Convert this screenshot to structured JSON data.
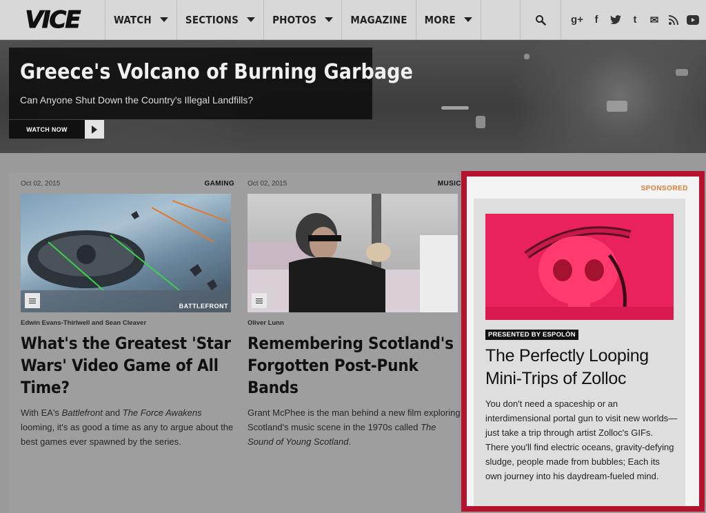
{
  "nav": {
    "logo": "VICE",
    "items": [
      {
        "label": "WATCH",
        "dropdown": true
      },
      {
        "label": "SECTIONS",
        "dropdown": true
      },
      {
        "label": "PHOTOS",
        "dropdown": true
      },
      {
        "label": "MAGAZINE",
        "dropdown": false
      },
      {
        "label": "MORE",
        "dropdown": true
      }
    ],
    "social": [
      {
        "name": "google-plus-icon",
        "glyph": "g+"
      },
      {
        "name": "facebook-icon",
        "glyph": "f"
      },
      {
        "name": "twitter-icon",
        "glyph": "t"
      },
      {
        "name": "tumblr-icon",
        "glyph": "t"
      },
      {
        "name": "mail-icon",
        "glyph": "✉"
      },
      {
        "name": "rss-icon",
        "glyph": "◥"
      },
      {
        "name": "youtube-icon",
        "glyph": "▶"
      }
    ]
  },
  "hero": {
    "title": "Greece's Volcano of Burning Garbage",
    "subtitle": "Can Anyone Shut Down the Country's Illegal Landfills?",
    "watch_label": "WATCH NOW"
  },
  "cards": [
    {
      "date": "Oct 02, 2015",
      "category": "GAMING",
      "author": "Edwin Evans-Thirlwell and Sean Cleaver",
      "title": "What's the Greatest 'Star Wars' Video Game of All Time?",
      "desc_parts": [
        "With EA's ",
        "Battlefront",
        " and ",
        "The Force Awakens",
        " looming, it's as good a time as any to argue about the best games ever spawned by the series."
      ]
    },
    {
      "date": "Oct 02, 2015",
      "category": "MUSIC",
      "author": "Oliver Lunn",
      "title": "Remembering Scotland's Forgotten Post-Punk Bands",
      "desc_parts": [
        "Grant McPhee is the man behind a new film exploring Scotland's music scene in the 1970s called ",
        "The Sound of Young Scotland",
        "."
      ]
    }
  ],
  "sponsored": {
    "label": "SPONSORED",
    "presented_by": "PRESENTED BY ESPOLÒN",
    "title": "The Perfectly Looping Mini-Trips of Zolloc",
    "desc": "You don't need a spaceship or an interdimensional portal gun to visit new worlds— just take a trip through artist Zolloc's GIFs. There you'll find electric oceans, gravity-defying sludge, people made from bubbles; Each its own journey into his daydream-fueled mind."
  },
  "thumb_badge": "BATTLEFRONT"
}
